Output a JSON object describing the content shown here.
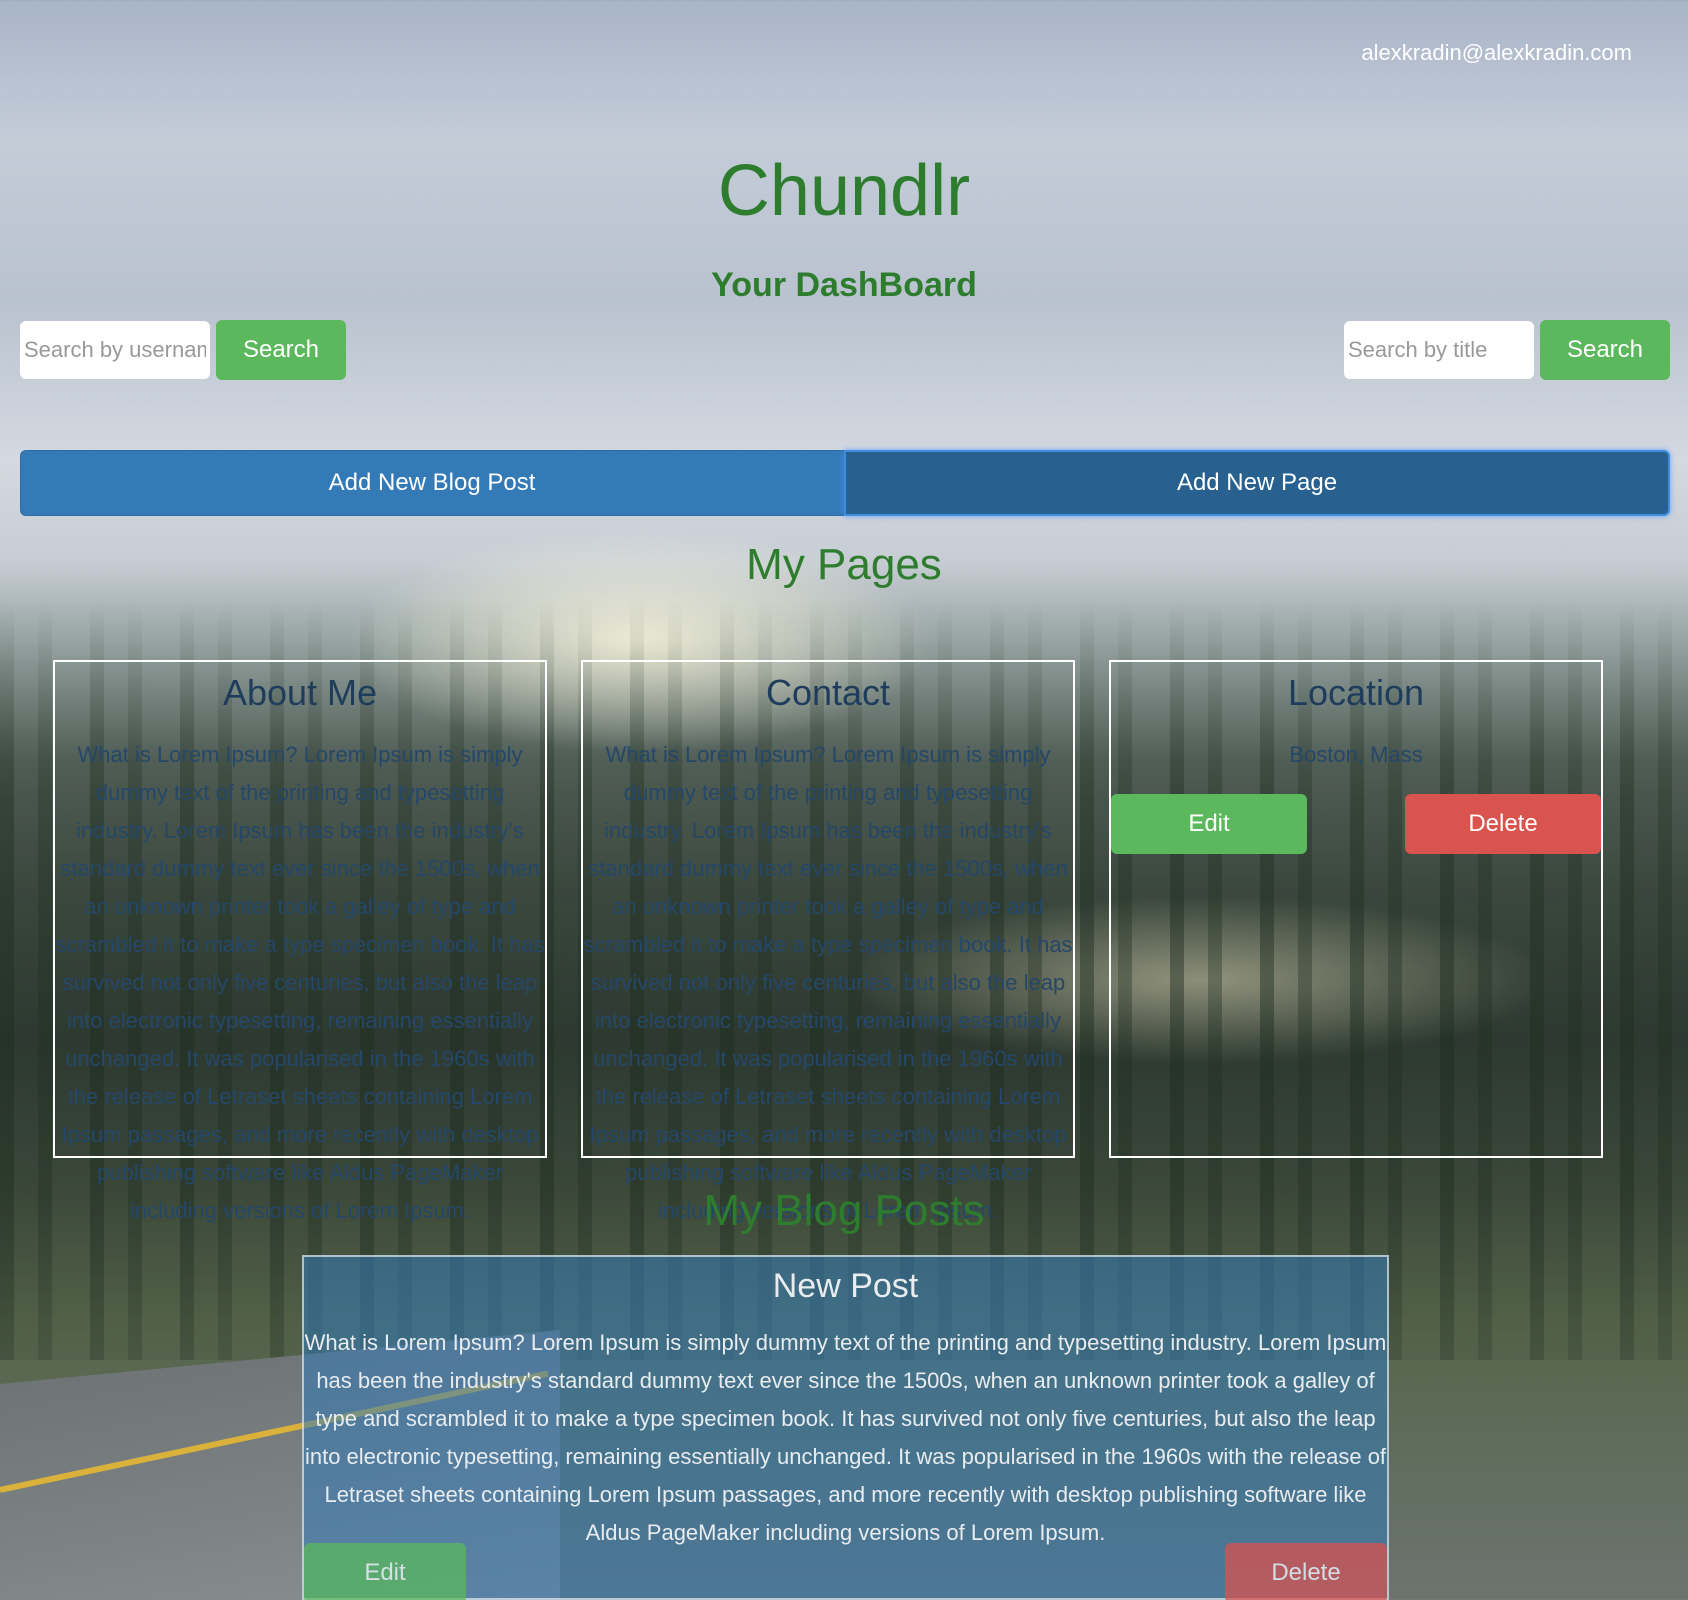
{
  "header": {
    "user_email": "alexkradin@alexkradin.com",
    "brand": "Chundlr",
    "subtitle": "Your DashBoard"
  },
  "search_user": {
    "placeholder": "Search by username",
    "button": "Search"
  },
  "search_title": {
    "placeholder": "Search by title",
    "button": "Search"
  },
  "actions": {
    "add_post": "Add New Blog Post",
    "add_page": "Add New Page"
  },
  "pages": {
    "title": "My Pages",
    "items": [
      {
        "title": "About Me",
        "body": "What is Lorem Ipsum? Lorem Ipsum is simply dummy text of the printing and typesetting industry. Lorem Ipsum has been the industry's standard dummy text ever since the 1500s, when an unknown printer took a galley of type and scrambled it to make a type specimen book. It has survived not only five centuries, but also the leap into electronic typesetting, remaining essentially unchanged. It was popularised in the 1960s with the release of Letraset sheets containing Lorem Ipsum passages, and more recently with desktop publishing software like Aldus PageMaker including versions of Lorem Ipsum."
      },
      {
        "title": "Contact",
        "body": "What is Lorem Ipsum? Lorem Ipsum is simply dummy text of the printing and typesetting industry. Lorem Ipsum has been the industry's standard dummy text ever since the 1500s, when an unknown printer took a galley of type and scrambled it to make a type specimen book. It has survived not only five centuries, but also the leap into electronic typesetting, remaining essentially unchanged. It was popularised in the 1960s with the release of Letraset sheets containing Lorem Ipsum passages, and more recently with desktop publishing software like Aldus PageMaker including versions of Lorem Ipsum."
      },
      {
        "title": "Location",
        "body": "Boston, Mass",
        "edit": "Edit",
        "delete": "Delete"
      }
    ]
  },
  "posts": {
    "title": "My Blog Posts",
    "items": [
      {
        "title": "New Post",
        "body": "What is Lorem Ipsum? Lorem Ipsum is simply dummy text of the printing and typesetting industry. Lorem Ipsum has been the industry's standard dummy text ever since the 1500s, when an unknown printer took a galley of type and scrambled it to make a type specimen book. It has survived not only five centuries, but also the leap into electronic typesetting, remaining essentially unchanged. It was popularised in the 1960s with the release of Letraset sheets containing Lorem Ipsum passages, and more recently with desktop publishing software like Aldus PageMaker including versions of Lorem Ipsum.",
        "edit": "Edit",
        "delete": "Delete"
      }
    ]
  },
  "colors": {
    "brand_green": "#2e7d2e",
    "success": "#5cb85c",
    "danger": "#d9534f",
    "primary": "#337ab7",
    "primary_active": "#286090"
  }
}
